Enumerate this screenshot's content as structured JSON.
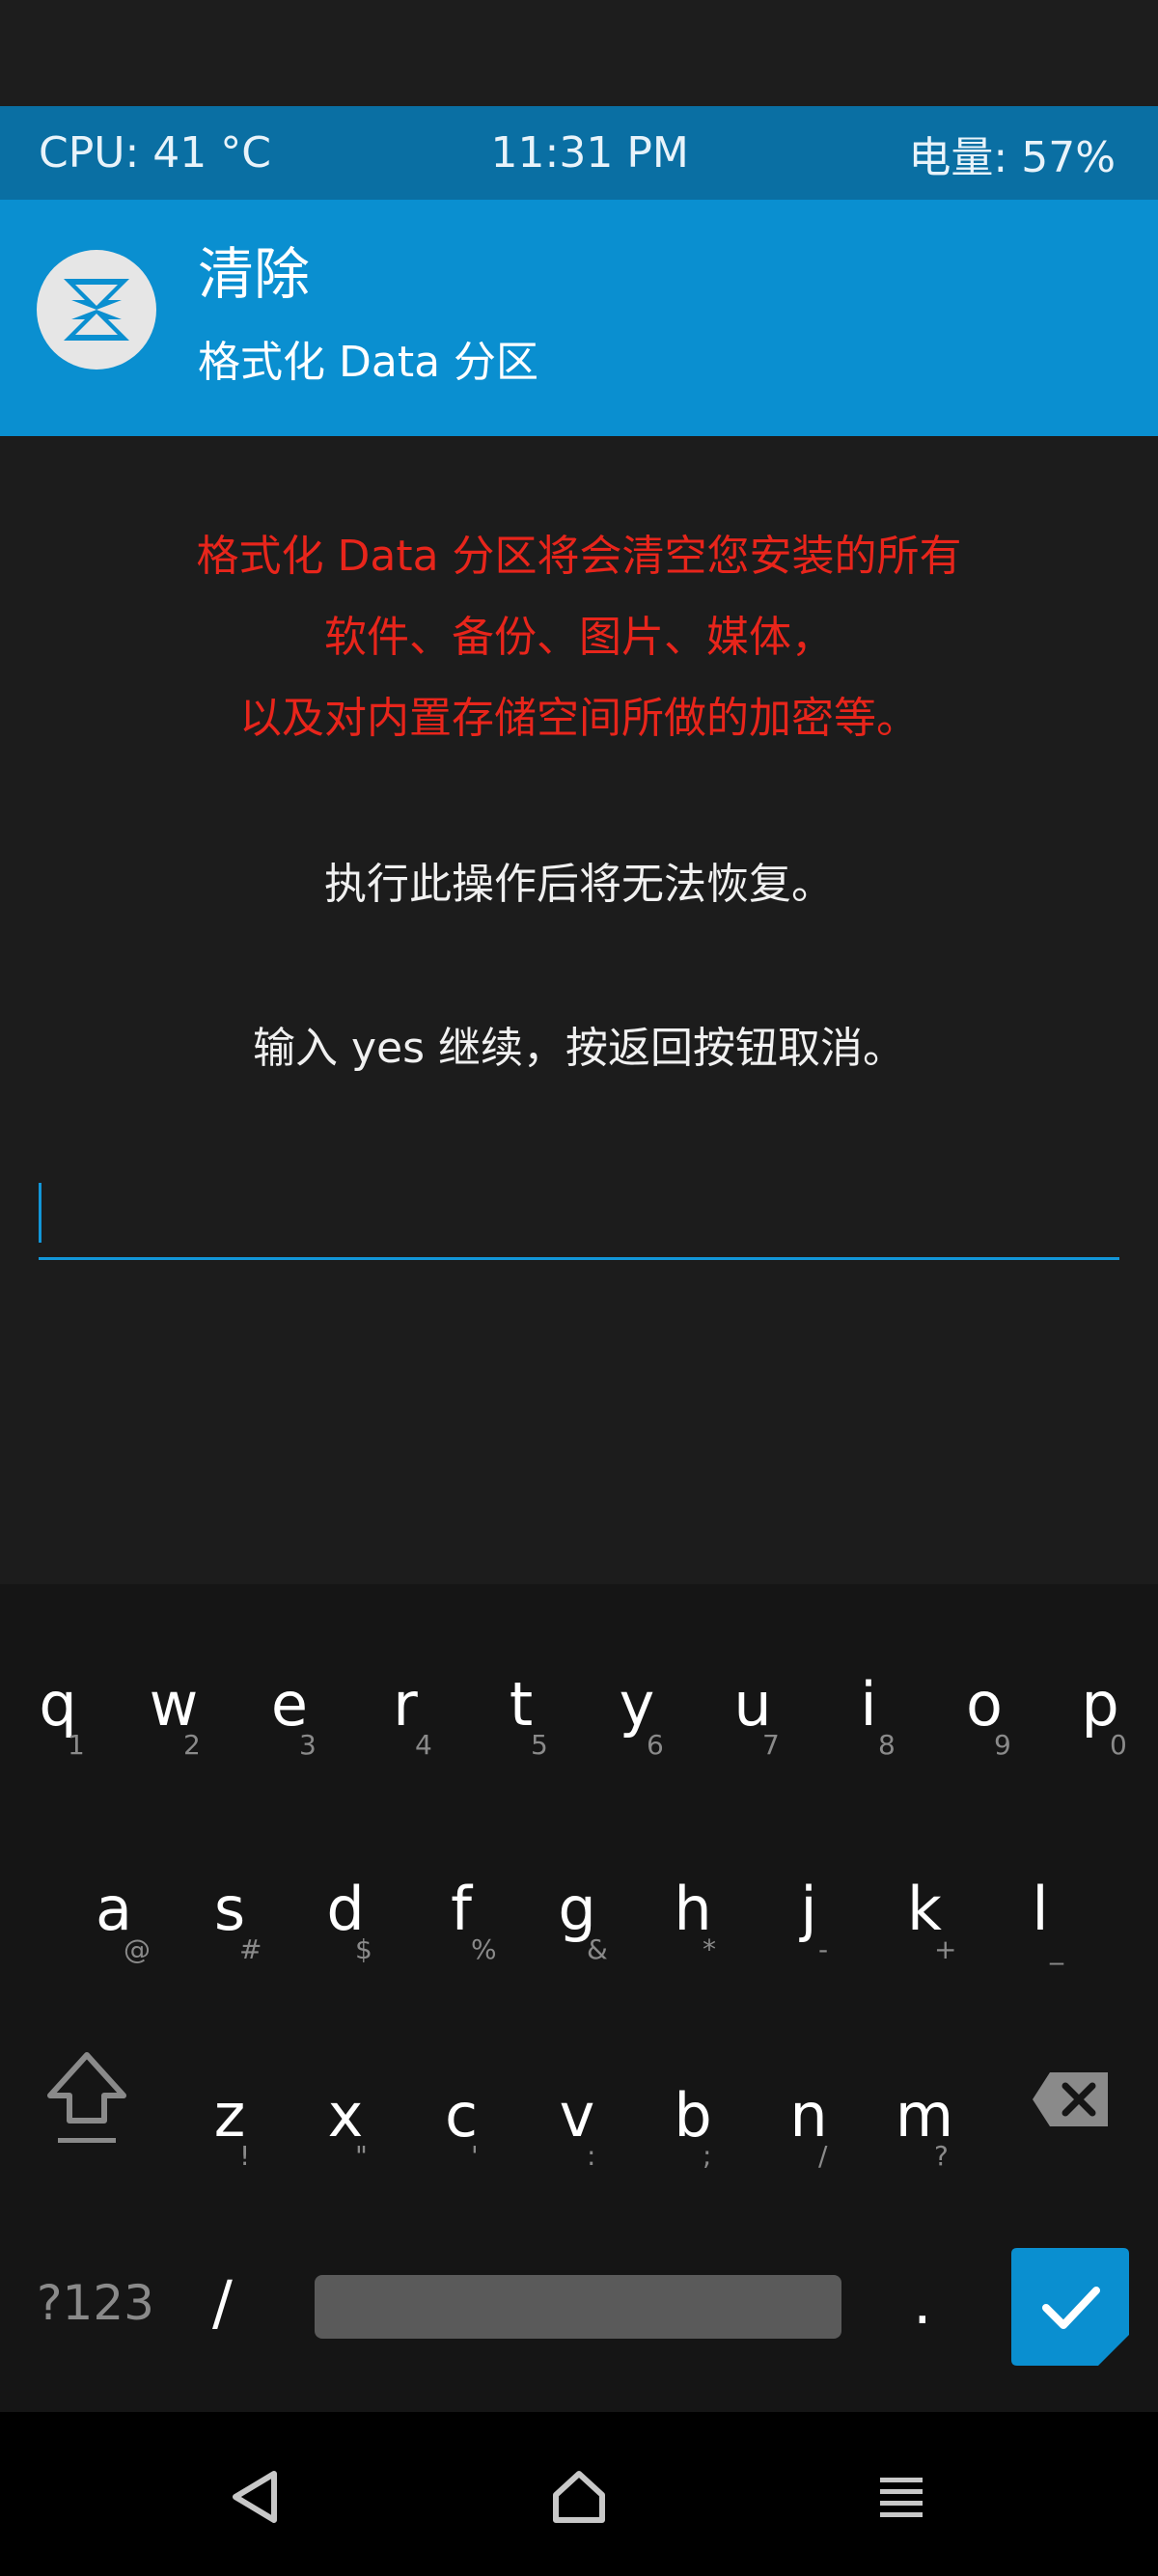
{
  "status": {
    "cpu": "CPU: 41 °C",
    "time": "11:31 PM",
    "battery": "电量: 57%"
  },
  "header": {
    "title": "清除",
    "subtitle": "格式化 Data 分区"
  },
  "warning": {
    "line1": "格式化 Data 分区将会清空您安装的所有",
    "line2": "软件、备份、图片、媒体，",
    "line3": "以及对内置存储空间所做的加密等。"
  },
  "info": {
    "irreversible": "执行此操作后将无法恢复。",
    "instruction": "输入 yes 继续，按返回按钮取消。"
  },
  "input": {
    "value": ""
  },
  "keyboard": {
    "row1": [
      {
        "ch": "q",
        "sub": "1"
      },
      {
        "ch": "w",
        "sub": "2"
      },
      {
        "ch": "e",
        "sub": "3"
      },
      {
        "ch": "r",
        "sub": "4"
      },
      {
        "ch": "t",
        "sub": "5"
      },
      {
        "ch": "y",
        "sub": "6"
      },
      {
        "ch": "u",
        "sub": "7"
      },
      {
        "ch": "i",
        "sub": "8"
      },
      {
        "ch": "o",
        "sub": "9"
      },
      {
        "ch": "p",
        "sub": "0"
      }
    ],
    "row2": [
      {
        "ch": "a",
        "sub": "@"
      },
      {
        "ch": "s",
        "sub": "#"
      },
      {
        "ch": "d",
        "sub": "$"
      },
      {
        "ch": "f",
        "sub": "%"
      },
      {
        "ch": "g",
        "sub": "&"
      },
      {
        "ch": "h",
        "sub": "*"
      },
      {
        "ch": "j",
        "sub": "-"
      },
      {
        "ch": "k",
        "sub": "+"
      },
      {
        "ch": "l",
        "sub": "_"
      }
    ],
    "row3": [
      {
        "ch": "z",
        "sub": "!"
      },
      {
        "ch": "x",
        "sub": "\""
      },
      {
        "ch": "c",
        "sub": "'"
      },
      {
        "ch": "v",
        "sub": ":"
      },
      {
        "ch": "b",
        "sub": ";"
      },
      {
        "ch": "n",
        "sub": "/"
      },
      {
        "ch": "m",
        "sub": "?"
      }
    ],
    "sym_label": "?123",
    "slash_label": "/",
    "dot_label": ".",
    "accent": "#0a8fd0"
  },
  "icons": {
    "shift": "shift-icon",
    "backspace": "backspace-icon",
    "enter": "checkmark-icon",
    "nav_back": "back-triangle-icon",
    "nav_home": "home-icon",
    "nav_menu": "menu-icon",
    "logo": "twrp-logo-icon"
  }
}
